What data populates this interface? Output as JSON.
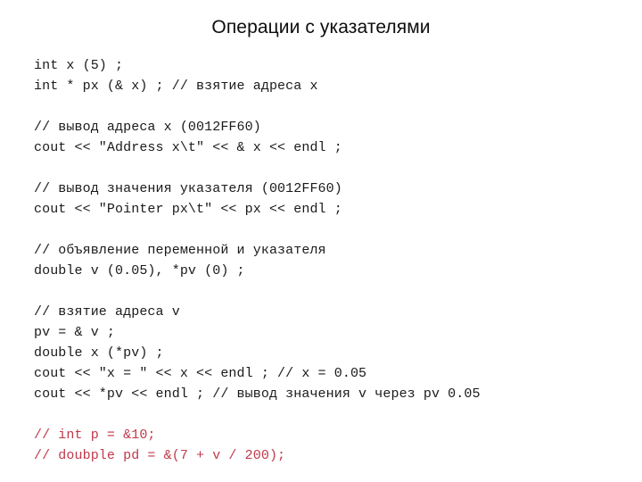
{
  "slide": {
    "title": "Операции с указателями",
    "background_color": "#ffffff",
    "text_color": "#1a1a1a",
    "accent_color": "#c0394b",
    "code_lines": [
      {
        "text": "int x (5) ;",
        "color": "default"
      },
      {
        "text": "int * px (& x) ; // взятие адреса x",
        "color": "default"
      },
      {
        "text": "",
        "color": "default"
      },
      {
        "text": "// вывод адреса x (0012FF60)",
        "color": "default"
      },
      {
        "text": "cout << \"Address x\\t\" << & x << endl ;",
        "color": "default"
      },
      {
        "text": "",
        "color": "default"
      },
      {
        "text": "// вывод значения указателя (0012FF60)",
        "color": "default"
      },
      {
        "text": "cout << \"Pointer px\\t\" << px << endl ;",
        "color": "default"
      },
      {
        "text": "",
        "color": "default"
      },
      {
        "text": "// объявление переменной и указателя",
        "color": "default"
      },
      {
        "text": "double v (0.05), *pv (0) ;",
        "color": "default"
      },
      {
        "text": "",
        "color": "default"
      },
      {
        "text": "// взятие адреса v",
        "color": "default"
      },
      {
        "text": "pv = & v ;",
        "color": "default"
      },
      {
        "text": "double x (*pv) ;",
        "color": "default"
      },
      {
        "text": "cout << \"x = \" << x << endl ; // x = 0.05",
        "color": "default"
      },
      {
        "text": "cout << *pv << endl ; // вывод значения v через pv 0.05",
        "color": "default"
      },
      {
        "text": "",
        "color": "default"
      },
      {
        "text": "// int p = &10;",
        "color": "red"
      },
      {
        "text": "// doubple pd = &(7 + v / 200);",
        "color": "red"
      }
    ]
  }
}
